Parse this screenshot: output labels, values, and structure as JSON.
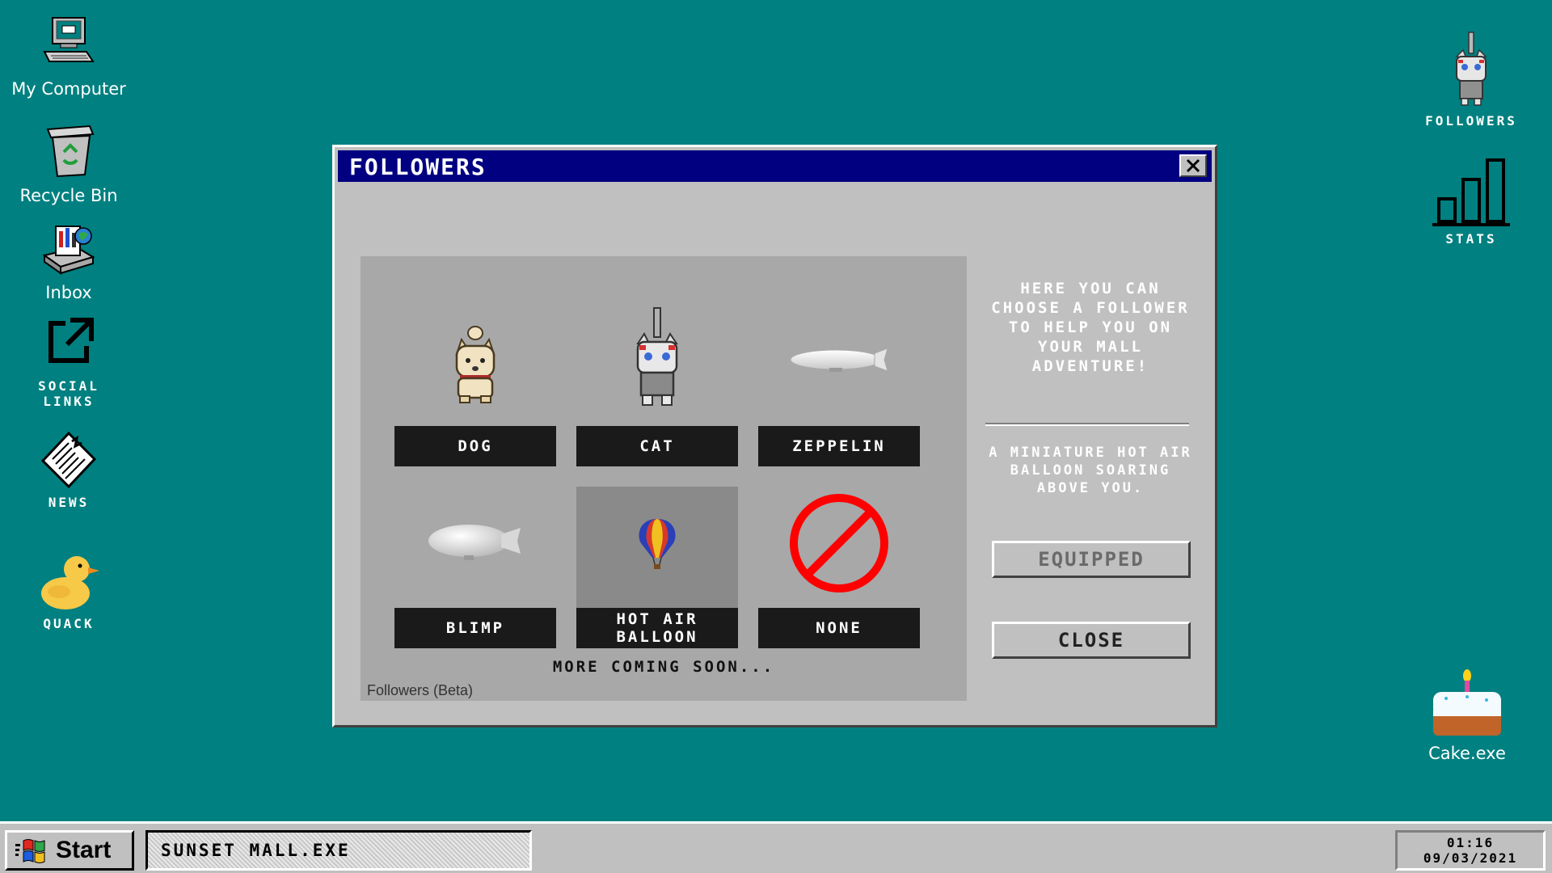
{
  "desktop": {
    "icons_left": [
      {
        "label": "My Computer",
        "icon": "computer-icon"
      },
      {
        "label": "Recycle Bin",
        "icon": "recycle-bin-icon"
      },
      {
        "label": "Inbox",
        "icon": "inbox-icon"
      },
      {
        "label": "SOCIAL\nLINKS",
        "icon": "external-link-icon"
      },
      {
        "label": "NEWS",
        "icon": "newspaper-icon"
      },
      {
        "label": "QUACK",
        "icon": "duck-icon"
      }
    ],
    "icons_right": [
      {
        "label": "FOLLOWERS",
        "icon": "cat-icon"
      },
      {
        "label": "STATS",
        "icon": "bar-chart-icon"
      },
      {
        "label": "Cake.exe",
        "icon": "cake-icon"
      }
    ]
  },
  "window": {
    "title": "FOLLOWERS",
    "followers": [
      {
        "name": "DOG",
        "icon": "dog-icon",
        "selected": false
      },
      {
        "name": "CAT",
        "icon": "cat-icon",
        "selected": false
      },
      {
        "name": "ZEPPELIN",
        "icon": "zeppelin-icon",
        "selected": false
      },
      {
        "name": "BLIMP",
        "icon": "blimp-icon",
        "selected": false
      },
      {
        "name": "HOT AIR\nBALLOON",
        "icon": "hot-air-balloon-icon",
        "selected": true
      },
      {
        "name": "NONE",
        "icon": "none-icon",
        "selected": false
      }
    ],
    "more_coming": "MORE COMING SOON...",
    "panel_caption": "Followers (Beta)",
    "intro": "HERE YOU CAN CHOOSE A FOLLOWER TO HELP YOU ON YOUR MALL ADVENTURE!",
    "description": "A MINIATURE HOT AIR BALLOON SOARING ABOVE YOU.",
    "equipped_label": "EQUIPPED",
    "close_label": "CLOSE"
  },
  "taskbar": {
    "start_label": "Start",
    "task_label": "SUNSET MALL.EXE",
    "clock_time": "01:16",
    "clock_date": "09/03/2021"
  },
  "colors": {
    "desktop": "#008080",
    "title_bar": "#000080",
    "window": "#c0c0c0",
    "label_bar": "#1a1a1a",
    "none_sign": "#ff0000"
  }
}
